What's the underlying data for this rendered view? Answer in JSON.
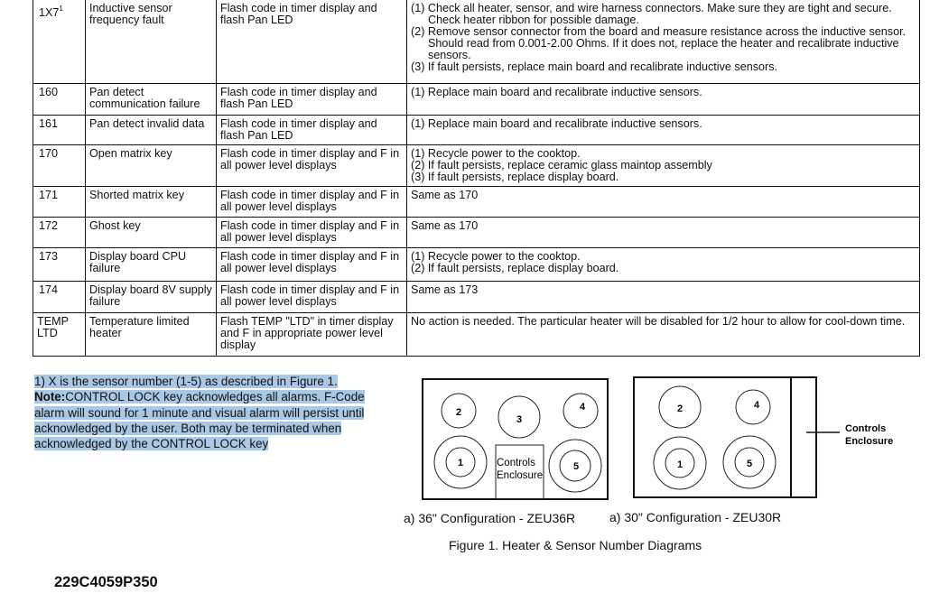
{
  "fault_table": {
    "rows": [
      {
        "code": "1X7",
        "code_footnote": "1",
        "description": "Inductive sensor frequency fault",
        "indication": "Flash code in timer display and flash Pan LED",
        "actions": [
          "(1) Check all heater, sensor, and wire harness connectors. Make sure they are tight and secure. Check heater ribbon for possible damage.",
          "(2) Remove sensor connector from the board and measure resistance across the inductive sensor. Should read from 0.001-2.00 Ohms. If it does not, replace the heater and recalibrate inductive sensors.",
          "(3) If fault persists, replace main board and recalibrate inductive sensors."
        ]
      },
      {
        "code": "160",
        "description": "Pan detect communication failure",
        "indication": "Flash code in timer display and flash Pan LED",
        "actions": [
          "(1) Replace main board and recalibrate inductive sensors."
        ]
      },
      {
        "code": "161",
        "description": "Pan detect invalid data",
        "indication": "Flash code in timer display and flash Pan LED",
        "actions": [
          "(1) Replace main board and recalibrate inductive sensors."
        ]
      },
      {
        "code": "170",
        "description": "Open matrix key",
        "indication": "Flash code in timer display and F in all power level displays",
        "actions": [
          "(1) Recycle power to the cooktop.",
          "(2) If fault persists, replace ceramic glass maintop assembly",
          "(3) If fault persists, replace display board."
        ]
      },
      {
        "code": "171",
        "description": "Shorted matrix key",
        "indication": "Flash code in timer display and F in all power level displays",
        "actions": [
          "Same as 170"
        ]
      },
      {
        "code": "172",
        "description": "Ghost key",
        "indication": "Flash code in timer display and F in all power level displays",
        "actions": [
          "Same as 170"
        ]
      },
      {
        "code": "173",
        "description": "Display board CPU failure",
        "indication": "Flash code in timer display and F in all power level displays",
        "actions": [
          "(1) Recycle power to the cooktop.",
          "(2) If fault persists, replace display board."
        ]
      },
      {
        "code": "174",
        "description": "Display board 8V supply failure",
        "indication": "Flash code in timer display and F in all power level displays",
        "actions": [
          "Same as 173"
        ]
      },
      {
        "code": "TEMP LTD",
        "description": "Temperature limited heater",
        "indication": "Flash TEMP \"LTD\" in timer display and F in appropriate power level display",
        "actions": [
          "No action is needed. The particular heater will be disabled for 1/2 hour to allow for cool-down time."
        ]
      }
    ]
  },
  "notes": {
    "footnote": "1) X is the sensor number (1-5) as described in Figure 1.",
    "note_label": "Note:",
    "note_text": "CONTROL LOCK key acknowledges all alarms. F-Code alarm will sound for 1 minute and visual alarm will persist until acknowledged  by the user. Both may be terminated when acknowledged by the CONTROL LOCK key",
    "highlight_color": "#a9c8e6"
  },
  "figure": {
    "left_diagram": {
      "heaters": [
        "1",
        "2",
        "3",
        "4",
        "5"
      ],
      "enclosure_label_line1": "Controls",
      "enclosure_label_line2": "Enclosure",
      "caption": "a) 36\" Configuration - ZEU36R"
    },
    "right_diagram": {
      "heaters": [
        "1",
        "2",
        "4",
        "5"
      ],
      "enclosure_label_line1": "Controls",
      "enclosure_label_line2": "Enclosure",
      "caption": "a) 30\" Configuration - ZEU30R"
    },
    "title": "Figure 1. Heater & Sensor Number Diagrams"
  },
  "footer": {
    "part_number": "229C4059P350"
  }
}
